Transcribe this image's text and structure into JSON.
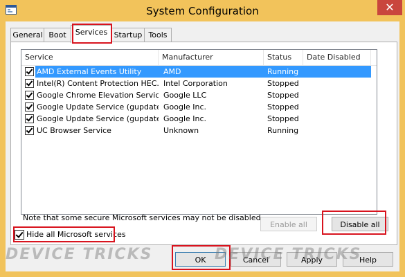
{
  "window": {
    "title": "System Configuration",
    "close_glyph": "✕"
  },
  "tabs": [
    {
      "label": "General"
    },
    {
      "label": "Boot"
    },
    {
      "label": "Services"
    },
    {
      "label": "Startup"
    },
    {
      "label": "Tools"
    }
  ],
  "columns": [
    "Service",
    "Manufacturer",
    "Status",
    "Date Disabled"
  ],
  "services": [
    {
      "name": "AMD External Events Utility",
      "manufacturer": "AMD",
      "status": "Running",
      "date": "",
      "checked": true
    },
    {
      "name": "Intel(R) Content Protection HEC...",
      "manufacturer": "Intel Corporation",
      "status": "Stopped",
      "date": "",
      "checked": true
    },
    {
      "name": "Google Chrome Elevation Service",
      "manufacturer": "Google LLC",
      "status": "Stopped",
      "date": "",
      "checked": true
    },
    {
      "name": "Google Update Service (gupdate)",
      "manufacturer": "Google Inc.",
      "status": "Stopped",
      "date": "",
      "checked": true
    },
    {
      "name": "Google Update Service (gupdatem)",
      "manufacturer": "Google Inc.",
      "status": "Stopped",
      "date": "",
      "checked": true
    },
    {
      "name": "UC Browser Service",
      "manufacturer": "Unknown",
      "status": "Running",
      "date": "",
      "checked": true
    }
  ],
  "note": "Note that some secure Microsoft services may not be disabled.",
  "enable_all": "Enable all",
  "disable_all": "Disable all",
  "hide_ms": {
    "label": "Hide all Microsoft services",
    "checked": true
  },
  "footer": {
    "ok": "OK",
    "cancel": "Cancel",
    "apply": "Apply",
    "help": "Help"
  },
  "watermark": "DEVICE TRICKS",
  "colors": {
    "title_bar": "#f2c35b",
    "selection": "#3399ff",
    "highlight": "#d8131e",
    "close": "#c9463d"
  }
}
